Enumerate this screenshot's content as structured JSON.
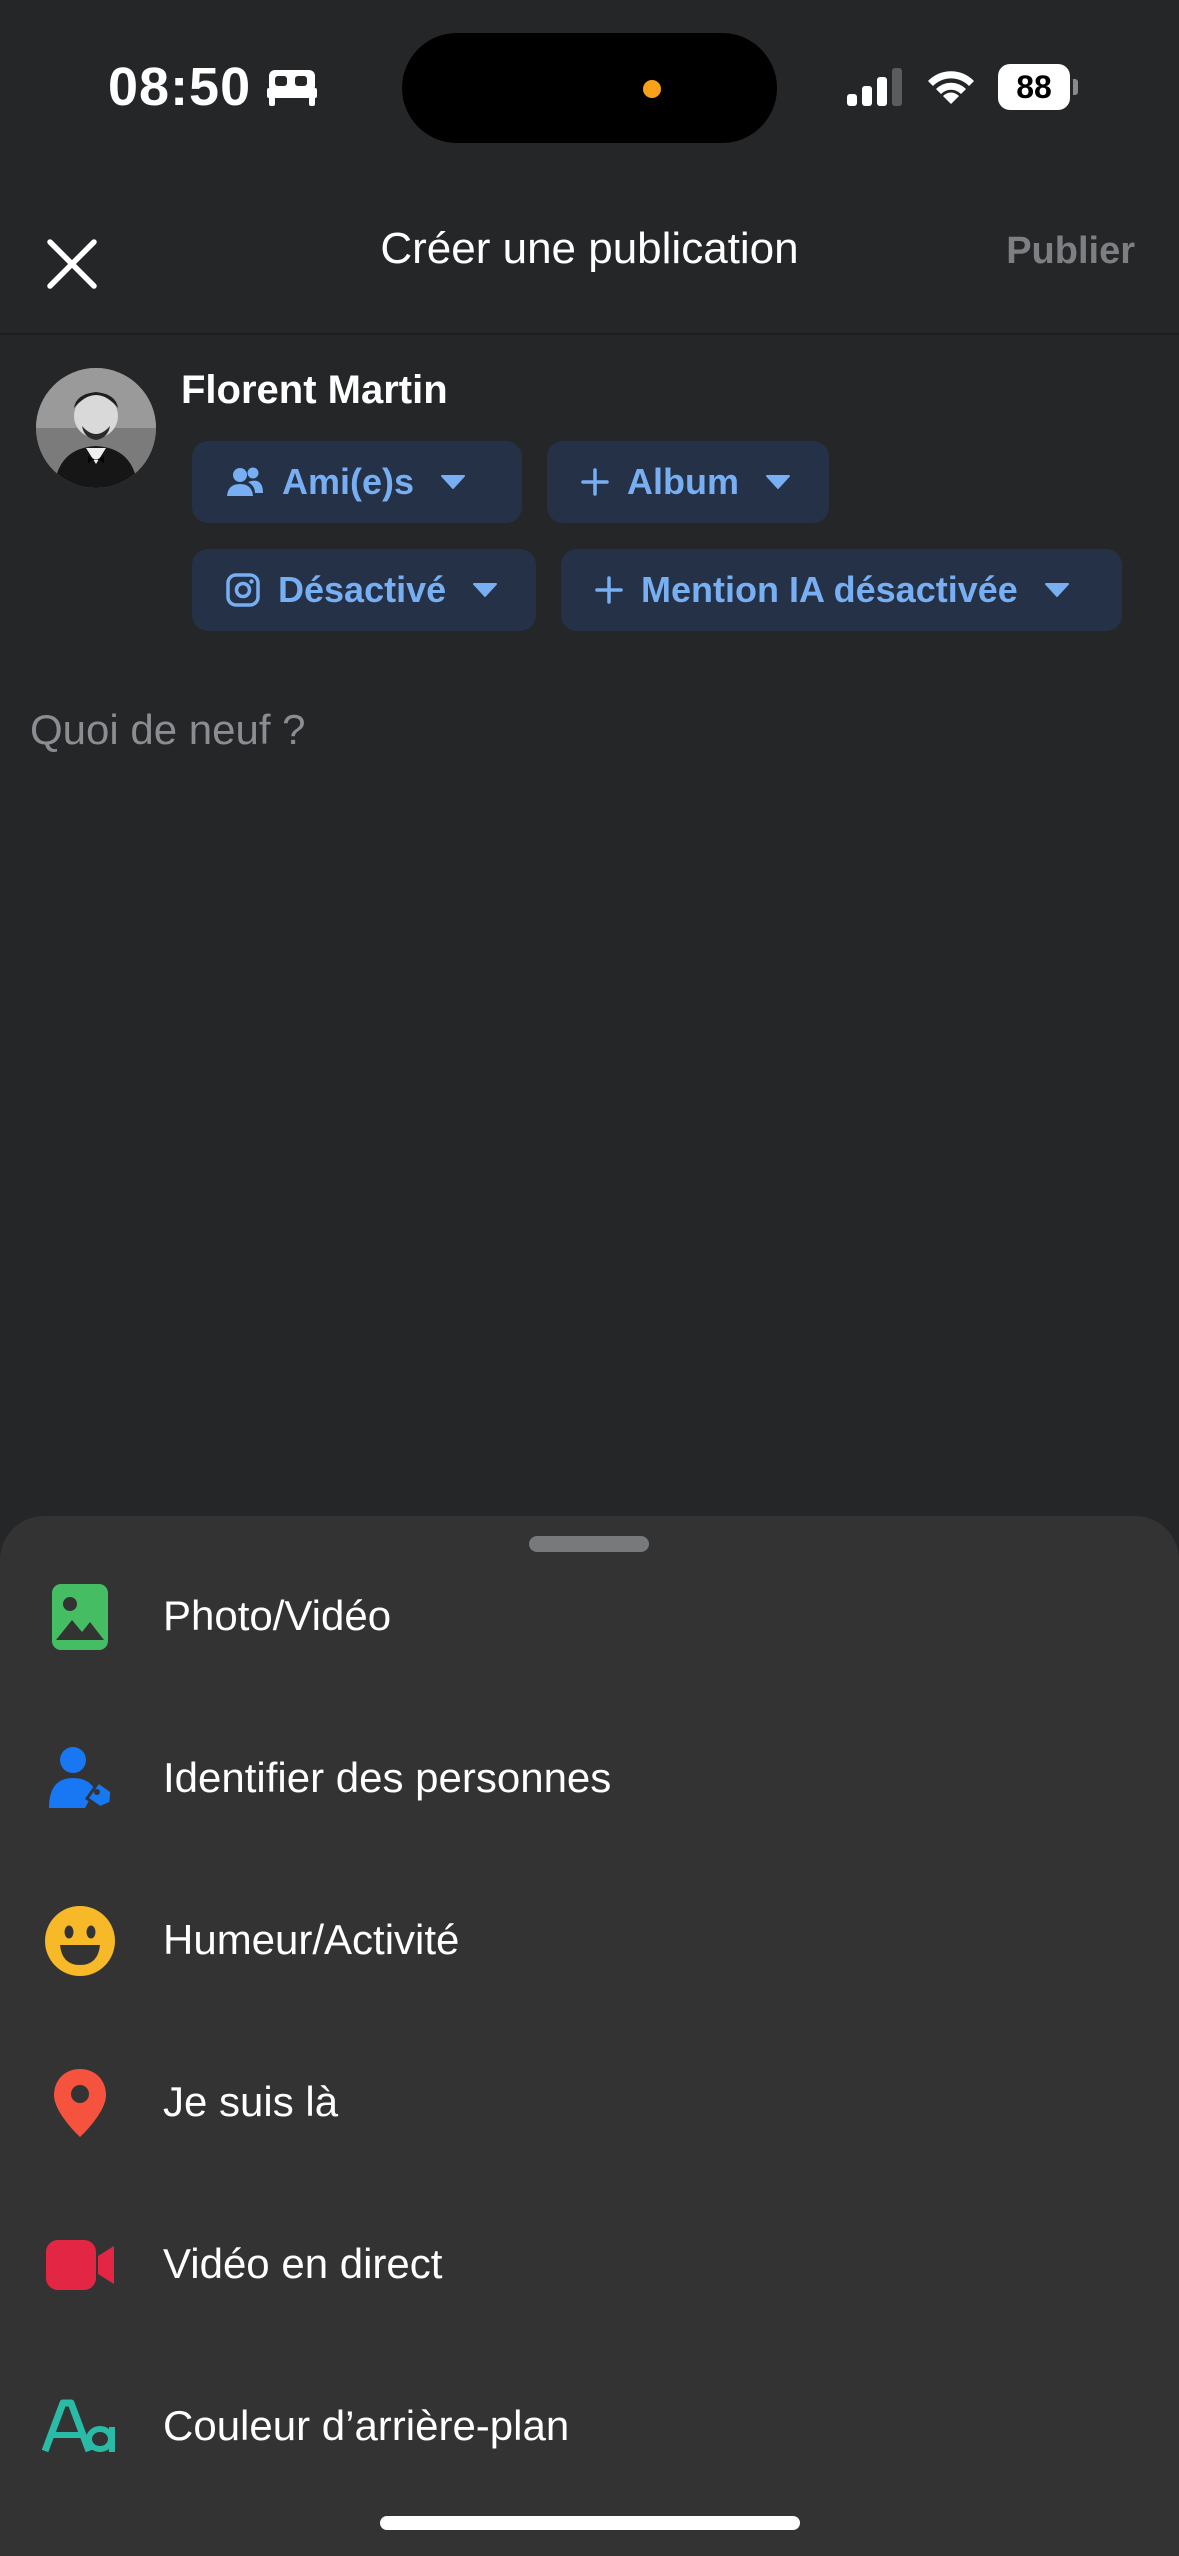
{
  "status_bar": {
    "time": "08:50",
    "battery": "88"
  },
  "header": {
    "title": "Créer une publication",
    "publish_label": "Publier"
  },
  "user": {
    "name": "Florent Martin"
  },
  "audience": {
    "privacy_label": "Ami(e)s",
    "album_label": "Album",
    "instagram_label": "Désactivé",
    "ai_label": "Mention IA désactivée"
  },
  "composer": {
    "placeholder": "Quoi de neuf ?"
  },
  "sheet": {
    "items": [
      {
        "label": "Photo/Vidéo",
        "icon": "photo-video-icon",
        "color": "#45bd62"
      },
      {
        "label": "Identifier des personnes",
        "icon": "tag-people-icon",
        "color": "#1877f2"
      },
      {
        "label": "Humeur/Activité",
        "icon": "feeling-emoji-icon",
        "color": "#f7b928"
      },
      {
        "label": "Je suis là",
        "icon": "location-pin-icon",
        "color": "#f5533d"
      },
      {
        "label": "Vidéo en direct",
        "icon": "live-video-icon",
        "color": "#e42645"
      },
      {
        "label": "Couleur d’arrière-plan",
        "icon": "background-color-icon",
        "color": "#2abba7"
      }
    ]
  },
  "colors": {
    "background": "#252628",
    "sheet": "#333334",
    "chip_bg": "#243147",
    "chip_text": "#78aef2"
  }
}
